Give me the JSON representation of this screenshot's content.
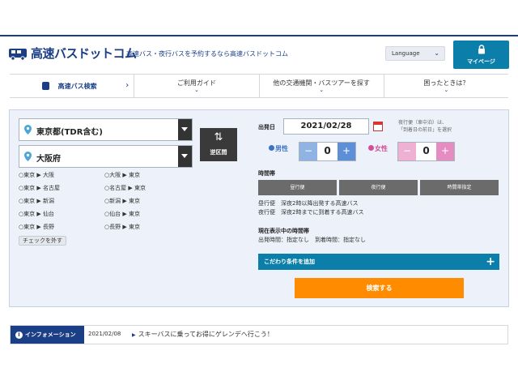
{
  "header": {
    "logo_text": "高速バスドットコム",
    "tagline": "高速バス・夜行バスを予約するなら高速バスドットコム",
    "language_label": "Language",
    "mypage_label": "マイページ"
  },
  "nav": {
    "items": [
      {
        "label": "高速バス検索",
        "icon": "bus-icon"
      },
      {
        "label": "ご利用ガイド"
      },
      {
        "label": "他の交通機関・バスツアーを探す"
      },
      {
        "label": "困ったときは？"
      }
    ]
  },
  "search": {
    "from": "東京都(TDR含む)",
    "to": "大阪府",
    "swap_label": "逆区間",
    "routes": [
      [
        "東京",
        "大阪"
      ],
      [
        "大阪",
        "東京"
      ],
      [
        "東京",
        "名古屋"
      ],
      [
        "名古屋",
        "東京"
      ],
      [
        "東京",
        "新潟"
      ],
      [
        "新潟",
        "東京"
      ],
      [
        "東京",
        "仙台"
      ],
      [
        "仙台",
        "東京"
      ],
      [
        "東京",
        "長野"
      ],
      [
        "長野",
        "東京"
      ]
    ],
    "uncheck_label": "チェックを外す",
    "date_label": "出発日",
    "date_value": "2021/02/28",
    "night_note_1": "夜行便（車中泊）は、",
    "night_note_2": "「到着日の前日」を選択",
    "male_label": "男性",
    "male_count": "0",
    "female_label": "女性",
    "female_count": "0",
    "time_label": "時間帯",
    "time_buttons": [
      "昼行便",
      "夜行便",
      "時間帯指定"
    ],
    "desc_day": "昼行便　深夜2時以降出発する高速バス",
    "desc_night": "夜行便　深夜2時までに到着する高速バス",
    "current_time_label": "現在表示中の時間帯",
    "current_time_value": "出発時間：指定なし　到着時間：指定なし",
    "kodawari_label": "こだわり条件を追加",
    "search_button": "検索する"
  },
  "info": {
    "tag": "インフォメーション",
    "date": "2021/02/08",
    "news": "スキーバスに乗ってお得にゲレンデへ行こう！"
  },
  "colors": {
    "brand": "#1b3f86",
    "accent_blue": "#0b7fa9",
    "search_orange": "#ff8c00",
    "male": "#3b72c9",
    "female": "#d2509a"
  }
}
